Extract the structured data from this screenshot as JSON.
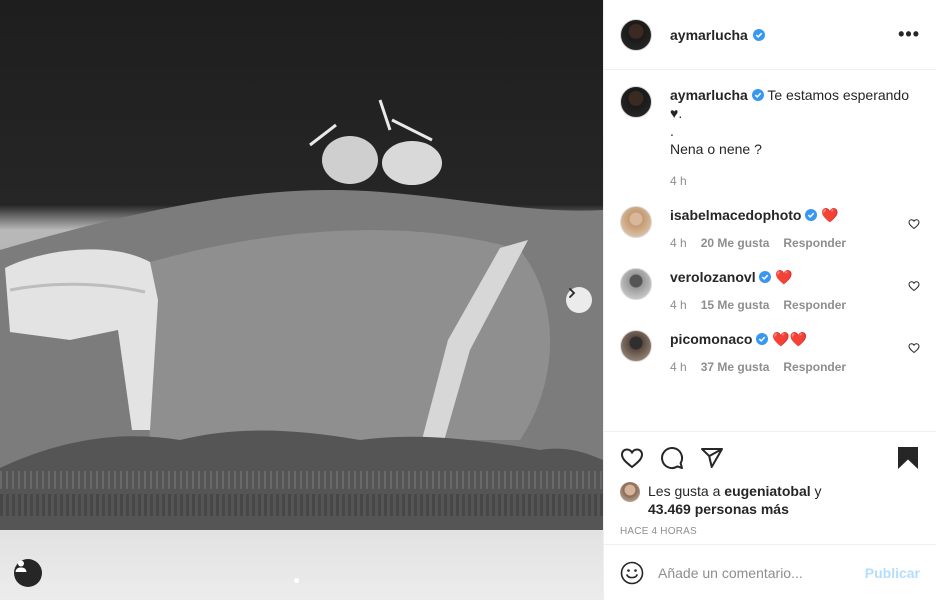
{
  "post": {
    "author": "aymarlucha",
    "caption_lines": [
      "Te estamos esperando",
      "♥.",
      ".",
      "Nena o nene ?"
    ],
    "caption_time": "4 h"
  },
  "comments": [
    {
      "user": "isabelmacedophoto",
      "text": "❤️",
      "time": "4 h",
      "likes": "20 Me gusta",
      "reply": "Responder"
    },
    {
      "user": "verolozanovl",
      "text": "❤️",
      "time": "4 h",
      "likes": "15 Me gusta",
      "reply": "Responder"
    },
    {
      "user": "picomonaco",
      "text": "❤️❤️",
      "time": "4 h",
      "likes": "37 Me gusta",
      "reply": "Responder"
    }
  ],
  "likes": {
    "prefix": "Les gusta a",
    "user": "eugeniatobal",
    "joiner": "y",
    "count": "43.469 personas más"
  },
  "timestamp": "HACE 4 HORAS",
  "add_comment": {
    "placeholder": "Añade un comentario...",
    "publish": "Publicar"
  },
  "colors": {
    "verified": "#3897f0",
    "publish_disabled": "#b2dffc",
    "heart_emoji": "#e0245e",
    "muted_text": "#8e8e8e"
  },
  "icons": [
    "more-icon",
    "verified-badge-icon",
    "heart-icon",
    "comment-icon",
    "share-icon",
    "bookmark-icon",
    "emoji-icon",
    "chevron-right-icon",
    "user-tag-icon"
  ]
}
